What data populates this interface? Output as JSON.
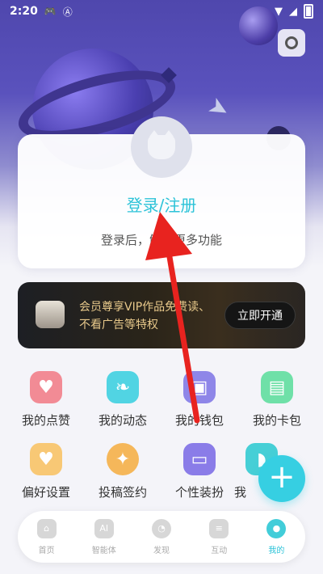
{
  "status_bar": {
    "time": "2:20",
    "icons": [
      "gamepad-icon",
      "a-icon"
    ],
    "right_icons": [
      "wifi-icon",
      "signal-icon",
      "battery-icon"
    ]
  },
  "settings": {
    "icon": "camera-settings-icon"
  },
  "login_card": {
    "title": "登录/注册",
    "subtitle": "登录后，解锁更多功能"
  },
  "vip": {
    "text_line1": "会员尊享VIP作品免费读、",
    "text_line2": "不看广告等特权",
    "button_label": "立即开通"
  },
  "grid": [
    {
      "label": "我的点赞",
      "icon": "heart-icon",
      "color": "#f28b95"
    },
    {
      "label": "我的动态",
      "icon": "leaf-icon",
      "color": "#51d4e3"
    },
    {
      "label": "我的钱包",
      "icon": "wallet-icon",
      "color": "#8e86e8"
    },
    {
      "label": "我的卡包",
      "icon": "card-icon",
      "color": "#6fe0a8"
    },
    {
      "label": "偏好设置",
      "icon": "heart-box-icon",
      "color": "#f8c875"
    },
    {
      "label": "投稿签约",
      "icon": "bulb-icon",
      "color": "#f5b75a"
    },
    {
      "label": "个性装扮",
      "icon": "store-icon",
      "color": "#8a7ce8"
    },
    {
      "label": "我",
      "icon": "fish-icon",
      "color": "#46cfd6"
    }
  ],
  "fab": {
    "label": "+"
  },
  "bottom_nav": [
    {
      "label": "首页",
      "icon": "home-icon"
    },
    {
      "label": "智能体",
      "icon": "ai-icon",
      "glyph": "AI"
    },
    {
      "label": "发现",
      "icon": "discover-icon"
    },
    {
      "label": "互动",
      "icon": "chat-icon"
    },
    {
      "label": "我的",
      "icon": "profile-icon"
    }
  ],
  "colors": {
    "accent": "#2cc3d8",
    "vip_gold": "#e8c98b",
    "arrow": "#e8231f"
  }
}
